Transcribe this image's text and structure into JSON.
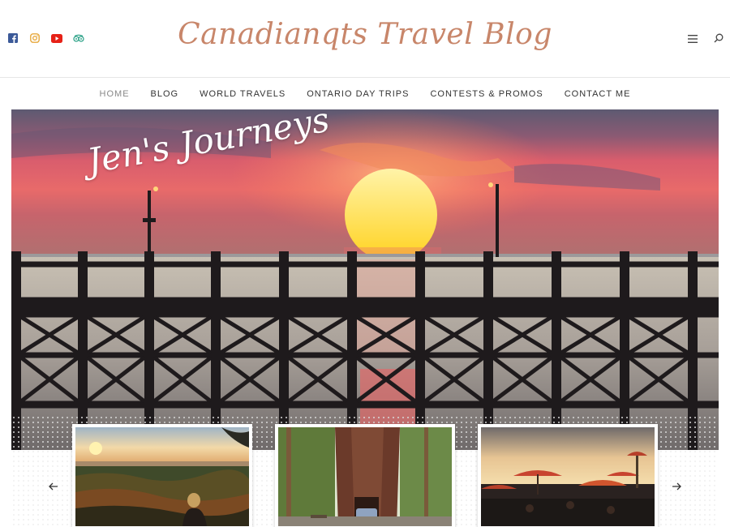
{
  "header": {
    "site_title": "Canadianqts Travel Blog",
    "social_icons": [
      "facebook-icon",
      "instagram-icon",
      "youtube-icon",
      "tripadvisor-icon"
    ],
    "right_icons": [
      "menu-icon",
      "search-icon"
    ]
  },
  "nav": {
    "items": [
      "HOME",
      "BLOG",
      "WORLD TRAVELS",
      "ONTARIO DAY TRIPS",
      "CONTESTS & PROMOS",
      "CONTACT ME"
    ],
    "active": "HOME"
  },
  "hero": {
    "caption": "Jen's Journeys"
  },
  "carousel": {
    "prev_icon": "arrow-left-icon",
    "next_icon": "arrow-right-icon",
    "slides": [
      "sunset-forest-overlook",
      "giant-redwood-tree-tunnel",
      "beach-umbrellas-sunset"
    ]
  },
  "colors": {
    "title": "#c8866a",
    "facebook": "#3b5998",
    "instagram": "#e7a83b",
    "youtube": "#e62117",
    "tripadvisor": "#34a58c"
  }
}
